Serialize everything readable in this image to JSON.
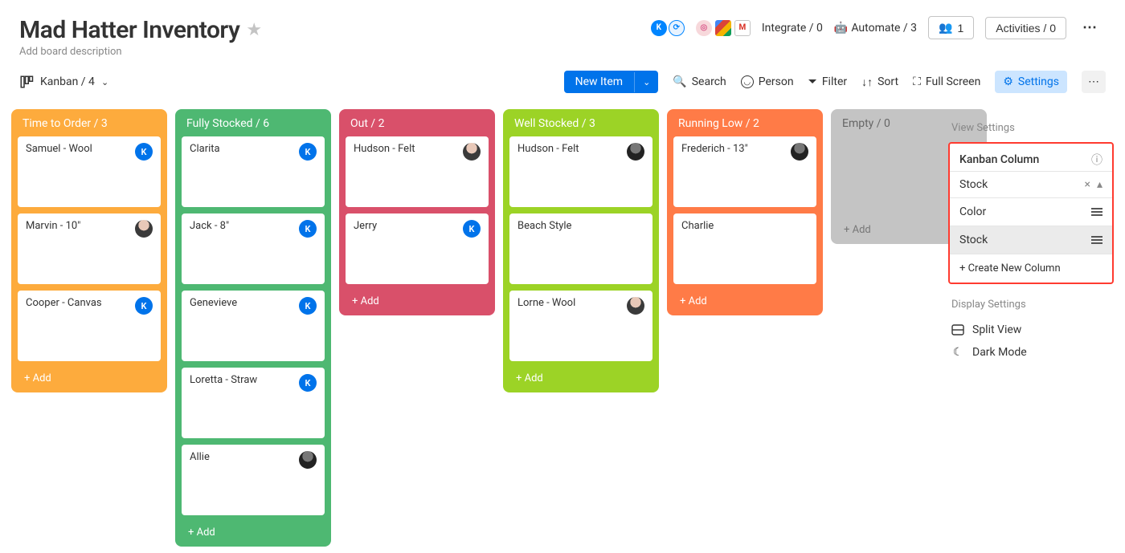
{
  "header": {
    "title": "Mad Hatter Inventory",
    "description": "Add board description",
    "integrate_label": "Integrate / 0",
    "automate_label": "Automate / 3",
    "members_label": "1",
    "activities_label": "Activities / 0"
  },
  "toolbar": {
    "view_name": "Kanban / 4",
    "new_item": "New Item",
    "search": "Search",
    "person": "Person",
    "filter": "Filter",
    "sort": "Sort",
    "fullscreen": "Full Screen",
    "settings": "Settings"
  },
  "columns": [
    {
      "name": "Time to Order",
      "count": 3,
      "color": "#fdab3d",
      "cards": [
        {
          "title": "Samuel - Wool",
          "avatar": "k"
        },
        {
          "title": "Marvin - 10\"",
          "avatar": "img"
        },
        {
          "title": "Cooper - Canvas",
          "avatar": "k"
        }
      ]
    },
    {
      "name": "Fully Stocked",
      "count": 6,
      "color": "#4eb872",
      "cards": [
        {
          "title": "Clarita",
          "avatar": "k"
        },
        {
          "title": "Jack - 8\"",
          "avatar": "k"
        },
        {
          "title": "Genevieve",
          "avatar": "k"
        },
        {
          "title": "Loretta - Straw",
          "avatar": "k"
        },
        {
          "title": "Allie",
          "avatar": "dark"
        }
      ]
    },
    {
      "name": "Out",
      "count": 2,
      "color": "#d9506a",
      "cards": [
        {
          "title": "Hudson - Felt",
          "avatar": "img"
        },
        {
          "title": "Jerry",
          "avatar": "k"
        }
      ]
    },
    {
      "name": "Well Stocked",
      "count": 3,
      "color": "#9cd326",
      "cards": [
        {
          "title": "Hudson - Felt",
          "avatar": "dark"
        },
        {
          "title": "Beach Style",
          "avatar": ""
        },
        {
          "title": "Lorne - Wool",
          "avatar": "img"
        }
      ]
    },
    {
      "name": "Running Low",
      "count": 2,
      "color": "#ff7b47",
      "cards": [
        {
          "title": "Frederich - 13\"",
          "avatar": "dark"
        },
        {
          "title": "Charlie",
          "avatar": ""
        }
      ]
    },
    {
      "name": "Empty",
      "count": 0,
      "color": "#c4c4c4",
      "cards": []
    }
  ],
  "add_label": "+ Add",
  "sidebar": {
    "view_settings": "View Settings",
    "kanban_column": "Kanban Column",
    "selected": "Stock",
    "options": [
      "Color",
      "Stock"
    ],
    "selected_option": "Stock",
    "create_new": "+ Create New Column",
    "display_settings": "Display Settings",
    "split_view": "Split View",
    "dark_mode": "Dark Mode"
  }
}
